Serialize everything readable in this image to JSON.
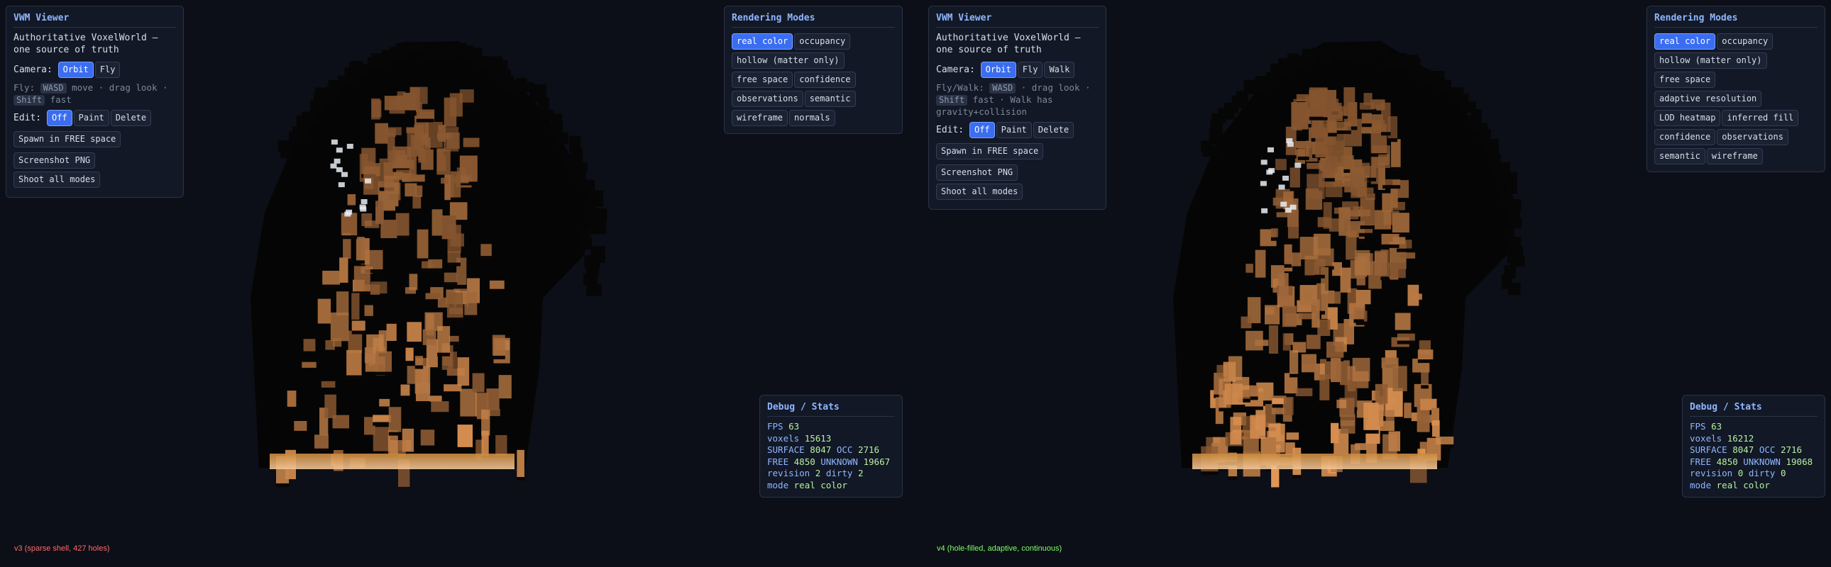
{
  "colors": {
    "background": "#0c0f17",
    "panel": "#121826",
    "accent": "#3b6df0",
    "title": "#8fb6ff",
    "stat_value": "#b8f0a0",
    "caption_v3": "#ff6a6a",
    "caption_v4": "#7dff6a"
  },
  "v3": {
    "viewer": {
      "title": "VWM Viewer",
      "subtitle": "Authoritative VoxelWorld — one source of truth",
      "camera_label": "Camera:",
      "camera_buttons": [
        "Orbit",
        "Fly"
      ],
      "hint": {
        "prefix": "Fly:",
        "key1": "WASD",
        "mid": "move · drag look ·",
        "key2": "Shift",
        "suffix": "fast"
      },
      "edit_label": "Edit:",
      "edit_buttons": [
        "Off",
        "Paint",
        "Delete"
      ],
      "spawn_button": "Spawn in FREE space",
      "screenshot_button": "Screenshot PNG",
      "shoot_all_button": "Shoot all modes"
    },
    "modes": {
      "title": "Rendering Modes",
      "items": [
        "real color",
        "occupancy",
        "hollow (matter only)",
        "free space",
        "confidence",
        "observations",
        "semantic",
        "wireframe",
        "normals"
      ]
    },
    "stats": {
      "title": "Debug / Stats",
      "fps": {
        "k": "FPS",
        "v": "63"
      },
      "voxels": {
        "k": "voxels",
        "v": "15613"
      },
      "surface": {
        "k": "SURFACE",
        "v": "8047"
      },
      "occ": {
        "k": "OCC",
        "v": "2716"
      },
      "free": {
        "k": "FREE",
        "v": "4850"
      },
      "unknown": {
        "k": "UNKNOWN",
        "v": "19667"
      },
      "revision": {
        "k": "revision",
        "v": "2"
      },
      "dirty": {
        "k": "dirty",
        "v": "2"
      },
      "mode": {
        "k": "mode",
        "v": "real color"
      }
    },
    "caption": "v3 (sparse shell, 427 holes)"
  },
  "v4": {
    "viewer": {
      "title": "VWM Viewer",
      "subtitle": "Authoritative VoxelWorld — one source of truth",
      "camera_label": "Camera:",
      "camera_buttons": [
        "Orbit",
        "Fly",
        "Walk"
      ],
      "hint": {
        "prefix": "Fly/Walk:",
        "key1": "WASD",
        "mid": "· drag look ·",
        "key2": "Shift",
        "suffix": "fast · Walk has gravity+collision"
      },
      "edit_label": "Edit:",
      "edit_buttons": [
        "Off",
        "Paint",
        "Delete"
      ],
      "spawn_button": "Spawn in FREE space",
      "screenshot_button": "Screenshot PNG",
      "shoot_all_button": "Shoot all modes"
    },
    "modes": {
      "title": "Rendering Modes",
      "items": [
        "real color",
        "occupancy",
        "hollow (matter only)",
        "free space",
        "adaptive resolution",
        "LOD heatmap",
        "inferred fill",
        "confidence",
        "observations",
        "semantic",
        "wireframe"
      ]
    },
    "stats": {
      "title": "Debug / Stats",
      "fps": {
        "k": "FPS",
        "v": "63"
      },
      "voxels": {
        "k": "voxels",
        "v": "16212"
      },
      "surface": {
        "k": "SURFACE",
        "v": "8047"
      },
      "occ": {
        "k": "OCC",
        "v": "2716"
      },
      "free": {
        "k": "FREE",
        "v": "4850"
      },
      "unknown": {
        "k": "UNKNOWN",
        "v": "19068"
      },
      "revision": {
        "k": "revision",
        "v": "0"
      },
      "dirty": {
        "k": "dirty",
        "v": "0"
      },
      "mode": {
        "k": "mode",
        "v": "real color"
      }
    },
    "caption": "v4 (hole-filled, adaptive, continuous)"
  }
}
